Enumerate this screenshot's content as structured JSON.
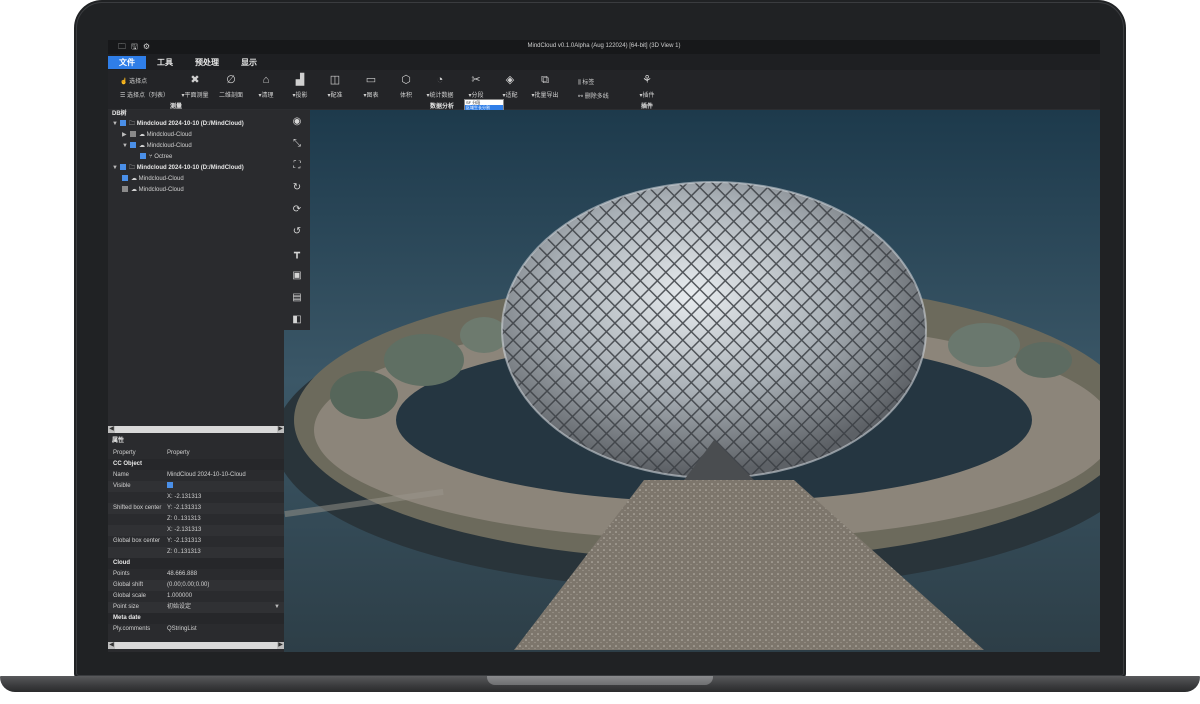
{
  "window": {
    "title": "MindCloud v0.1.0Alpha  (Aug 122024)  [64-bit] (3D View 1)",
    "quick_icons": [
      "🗀",
      "🖫",
      "⚙"
    ]
  },
  "menu": [
    {
      "label": "文件",
      "active": true
    },
    {
      "label": "工具",
      "active": false
    },
    {
      "label": "预处理",
      "active": false
    },
    {
      "label": "显示",
      "active": false
    }
  ],
  "ribbon": {
    "pick_point": "选择点",
    "pick_point_list": "选择点（列表）",
    "tools": [
      {
        "icon": "✖",
        "label": "▾平面测量"
      },
      {
        "icon": "∅",
        "label": "二维剖面"
      },
      {
        "icon": "⌂",
        "label": "▾清理"
      },
      {
        "icon": "▟",
        "label": "▾投影"
      },
      {
        "icon": "◫",
        "label": "▾配准"
      },
      {
        "icon": "▭",
        "label": "▾图表"
      },
      {
        "icon": "⬡",
        "label": "体积"
      },
      {
        "icon": "◔",
        "label": "▾统计数据"
      },
      {
        "icon": "✂",
        "label": "▾分段"
      },
      {
        "icon": "◈",
        "label": "▾适配"
      },
      {
        "icon": "⧉",
        "label": "▾批量导出"
      },
      {
        "icon": "⚘",
        "label": "▾插件"
      }
    ],
    "label_tool": "⫼ 标签",
    "delete_multi": "⚯ 删除多线",
    "groups": {
      "measure": "测量",
      "analysis": "数据分析",
      "plugin": "插件"
    },
    "dropdown_options": [
      "SF 分段",
      "区域生长分割"
    ]
  },
  "db_tree": {
    "title": "DB树",
    "items": [
      {
        "level": 0,
        "arrow": "▼",
        "check": "blue",
        "icon": "🗀",
        "text": "Mindcloud 2024-10-10  (D:/MindCloud)",
        "bold": true
      },
      {
        "level": 1,
        "arrow": "▶",
        "check": "gray",
        "icon": "☁",
        "text": "Mindcloud-Cloud",
        "bold": false
      },
      {
        "level": 1,
        "arrow": "▼",
        "check": "blue",
        "icon": "☁",
        "text": "Mindcloud-Cloud",
        "bold": false
      },
      {
        "level": 2,
        "arrow": "",
        "check": "blue",
        "icon": "⑂",
        "text": "Octree",
        "bold": false
      },
      {
        "level": 0,
        "arrow": "▼",
        "check": "blue",
        "icon": "🗀",
        "text": "Mindcloud 2024-10-10  (D:/MindCloud)",
        "bold": true
      },
      {
        "level": 1,
        "arrow": "",
        "check": "blue",
        "icon": "☁",
        "text": "Mindcloud-Cloud",
        "bold": false
      },
      {
        "level": 1,
        "arrow": "",
        "check": "gray",
        "icon": "☁",
        "text": "Mindcloud-Cloud",
        "bold": false
      }
    ]
  },
  "properties": {
    "title": "属性",
    "rows": [
      {
        "type": "row",
        "k": "Property",
        "v": "Property"
      },
      {
        "type": "hdr",
        "k": "CC Object",
        "v": ""
      },
      {
        "type": "row",
        "k": "Name",
        "v": "MindCloud 2024-10-10-Cloud"
      },
      {
        "type": "check",
        "k": "Visible",
        "v": ""
      },
      {
        "type": "row",
        "k": "",
        "v": "X:  -2.131313"
      },
      {
        "type": "row",
        "k": "Shifted box center",
        "v": "Y:  -2.131313"
      },
      {
        "type": "row",
        "k": "",
        "v": "Z:  0..131313"
      },
      {
        "type": "row",
        "k": "",
        "v": "X:  -2.131313"
      },
      {
        "type": "row",
        "k": "Global box center",
        "v": "Y:  -2.131313"
      },
      {
        "type": "row",
        "k": "",
        "v": "Z:  0..131313"
      },
      {
        "type": "hdr",
        "k": "Cloud",
        "v": ""
      },
      {
        "type": "row",
        "k": "Points",
        "v": "48.666.888"
      },
      {
        "type": "row",
        "k": "Global shift",
        "v": "(0.00;0.00;0.00)"
      },
      {
        "type": "row",
        "k": "Global scale",
        "v": "1.000000"
      },
      {
        "type": "select",
        "k": "Point size",
        "v": "初始设定"
      },
      {
        "type": "hdr",
        "k": "Meta date",
        "v": ""
      },
      {
        "type": "row",
        "k": "Ply.comments",
        "v": "QStringList"
      }
    ]
  },
  "view_toolbar": [
    "◉",
    "⤡",
    "⛶",
    "↻",
    "⟳",
    "↺",
    "┳",
    "▣",
    "▤",
    "◧"
  ],
  "colors": {
    "accent": "#2f7ee8",
    "panel": "#2a2b2e",
    "sky_top": "#1c3b4d",
    "ground": "#8a8378"
  }
}
